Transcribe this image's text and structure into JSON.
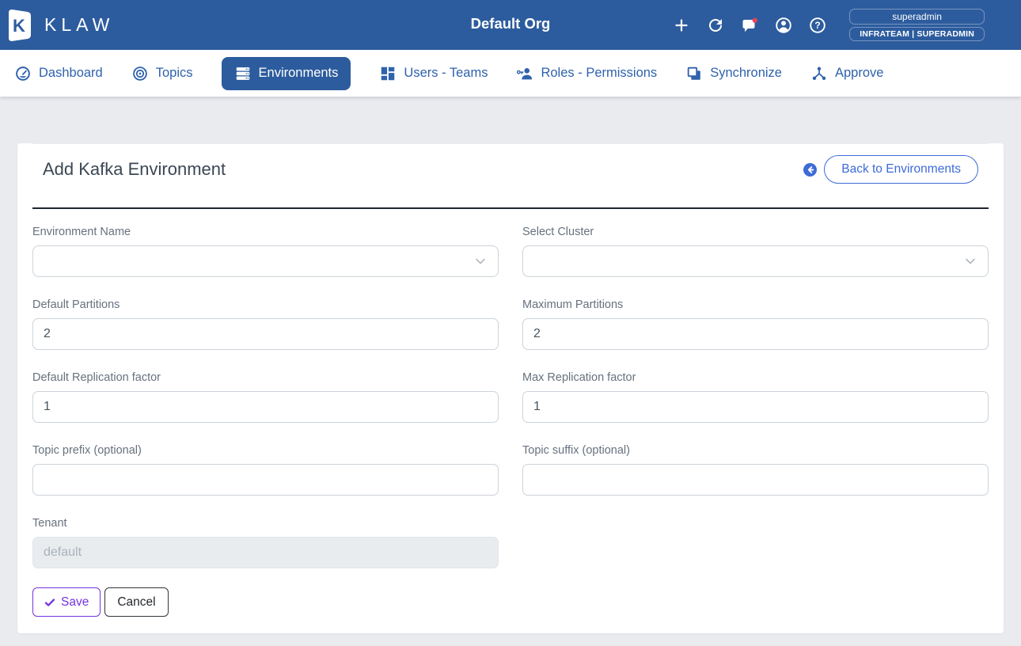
{
  "header": {
    "brand": "KLAW",
    "logo_letter": "K",
    "org_title": "Default Org",
    "username": "superadmin",
    "team_role": "INFRATEAM | SUPERADMIN",
    "icons": [
      "plus-icon",
      "refresh-icon",
      "messages-icon",
      "account-icon",
      "help-icon"
    ],
    "messages_badge": "unread-dot"
  },
  "nav": {
    "items": [
      {
        "label": "Dashboard",
        "icon": "dashboard-gauge-icon",
        "active": false
      },
      {
        "label": "Topics",
        "icon": "topics-target-icon",
        "active": false
      },
      {
        "label": "Environments",
        "icon": "environments-server-icon",
        "active": true
      },
      {
        "label": "Users - Teams",
        "icon": "users-teams-grid-icon",
        "active": false
      },
      {
        "label": "Roles - Permissions",
        "icon": "roles-key-person-icon",
        "active": false
      },
      {
        "label": "Synchronize",
        "icon": "synchronize-copy-icon",
        "active": false
      },
      {
        "label": "Approve",
        "icon": "approve-hub-icon",
        "active": false
      }
    ]
  },
  "page": {
    "title": "Add Kafka Environment",
    "back_button_label": "Back to Environments"
  },
  "form": {
    "fields": [
      {
        "label": "Environment Name",
        "type": "select",
        "value": ""
      },
      {
        "label": "Select Cluster",
        "type": "select",
        "value": ""
      },
      {
        "label": "Default Partitions",
        "type": "input",
        "value": "2"
      },
      {
        "label": "Maximum Partitions",
        "type": "input",
        "value": "2"
      },
      {
        "label": "Default Replication factor",
        "type": "input",
        "value": "1"
      },
      {
        "label": "Max Replication factor",
        "type": "input",
        "value": "1"
      },
      {
        "label": "Topic prefix (optional)",
        "type": "input",
        "value": ""
      },
      {
        "label": "Topic suffix (optional)",
        "type": "input",
        "value": ""
      },
      {
        "label": "Tenant",
        "type": "input-disabled",
        "value": "",
        "placeholder": "default"
      }
    ],
    "save_label": "Save",
    "cancel_label": "Cancel"
  },
  "colors": {
    "header_blue": "#2d5c9e",
    "nav_link_blue": "#2f62ac",
    "back_button_blue": "#3e6bd8",
    "save_purple": "#7633e0",
    "badge_red": "#ef4056",
    "page_bg": "#e9ebef"
  }
}
